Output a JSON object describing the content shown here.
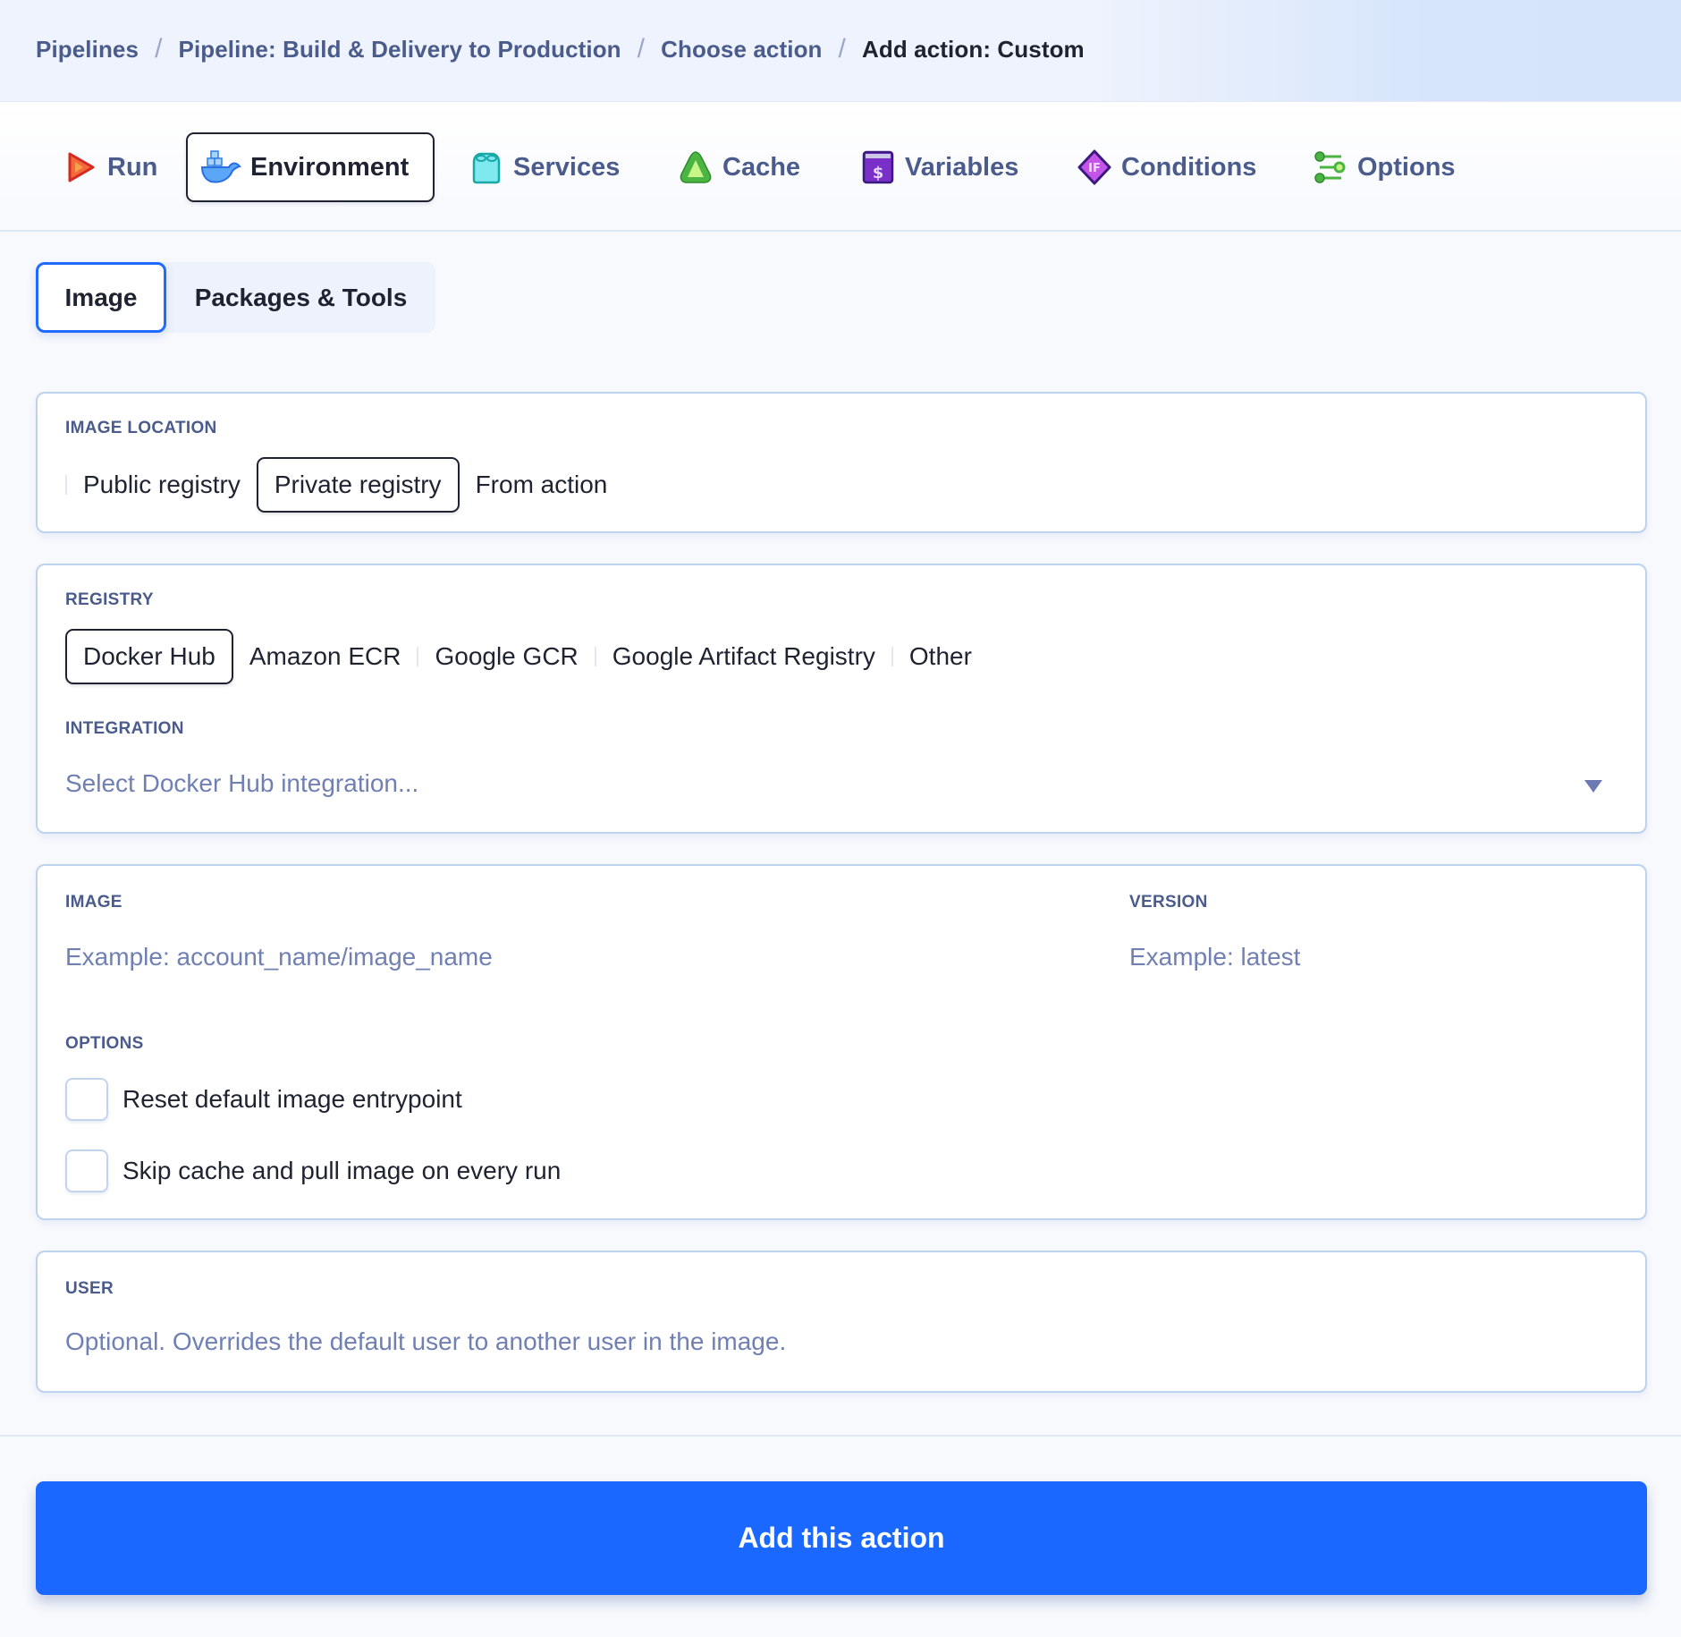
{
  "breadcrumb": {
    "items": [
      "Pipelines",
      "Pipeline: Build & Delivery to Production",
      "Choose action",
      "Add action: Custom"
    ],
    "separator": "/"
  },
  "tabs": [
    {
      "label": "Run",
      "icon": "run-play-icon",
      "active": false
    },
    {
      "label": "Environment",
      "icon": "docker-whale-icon",
      "active": true
    },
    {
      "label": "Services",
      "icon": "services-block-icon",
      "active": false
    },
    {
      "label": "Cache",
      "icon": "cache-triangle-icon",
      "active": false
    },
    {
      "label": "Variables",
      "icon": "variables-dollar-icon",
      "active": false
    },
    {
      "label": "Conditions",
      "icon": "conditions-if-icon",
      "active": false
    },
    {
      "label": "Options",
      "icon": "options-sliders-icon",
      "active": false
    }
  ],
  "subtabs": [
    {
      "label": "Image",
      "active": true
    },
    {
      "label": "Packages & Tools",
      "active": false
    }
  ],
  "image_location": {
    "label": "IMAGE LOCATION",
    "options": [
      "Public registry",
      "Private registry",
      "From action"
    ],
    "selected": "Private registry"
  },
  "registry": {
    "label": "REGISTRY",
    "options": [
      "Docker Hub",
      "Amazon ECR",
      "Google GCR",
      "Google Artifact Registry",
      "Other"
    ],
    "selected": "Docker Hub"
  },
  "integration": {
    "label": "INTEGRATION",
    "placeholder": "Select Docker Hub integration..."
  },
  "image": {
    "label": "IMAGE",
    "placeholder": "Example: account_name/image_name"
  },
  "version": {
    "label": "VERSION",
    "placeholder": "Example: latest"
  },
  "options": {
    "label": "OPTIONS",
    "checkboxes": [
      {
        "label": "Reset default image entrypoint",
        "checked": false
      },
      {
        "label": "Skip cache and pull image on every run",
        "checked": false
      }
    ]
  },
  "user": {
    "label": "USER",
    "placeholder": "Optional. Overrides the default user to another user in the image."
  },
  "submit": {
    "label": "Add this action"
  },
  "colors": {
    "primary": "#1a68ff",
    "label_text": "#4a5b8c",
    "placeholder_text": "#7080b2",
    "card_border": "#bcd2ef"
  }
}
